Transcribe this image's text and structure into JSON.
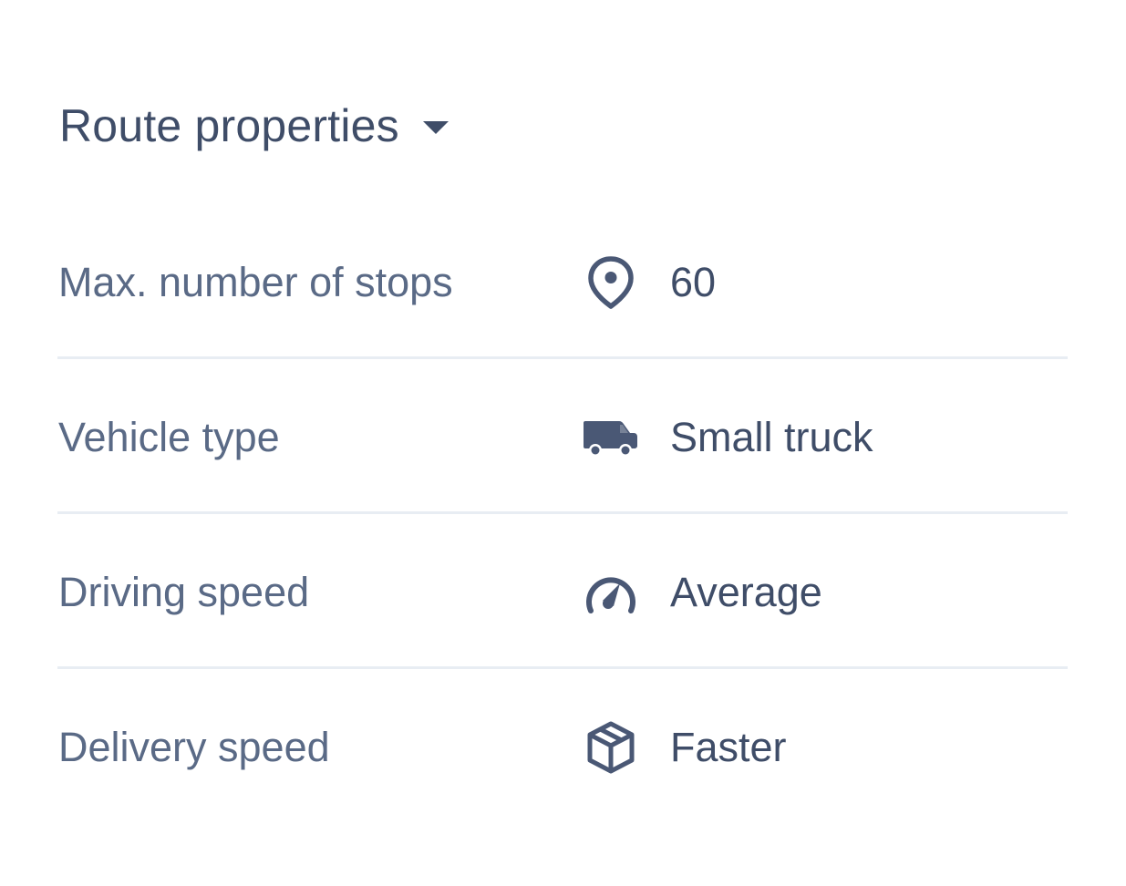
{
  "section": {
    "title": "Route properties",
    "toggle_icon": "caret-down-icon"
  },
  "properties": [
    {
      "label": "Max. number of stops",
      "icon": "map-pin-icon",
      "value": "60"
    },
    {
      "label": "Vehicle type",
      "icon": "truck-icon",
      "value": "Small truck"
    },
    {
      "label": "Driving speed",
      "icon": "speedometer-icon",
      "value": "Average"
    },
    {
      "label": "Delivery speed",
      "icon": "package-icon",
      "value": "Faster"
    }
  ],
  "colors": {
    "text_primary": "#3f4d68",
    "text_secondary": "#5a6a86",
    "divider": "#e8edf3",
    "icon": "#4a5875",
    "background": "#ffffff"
  }
}
